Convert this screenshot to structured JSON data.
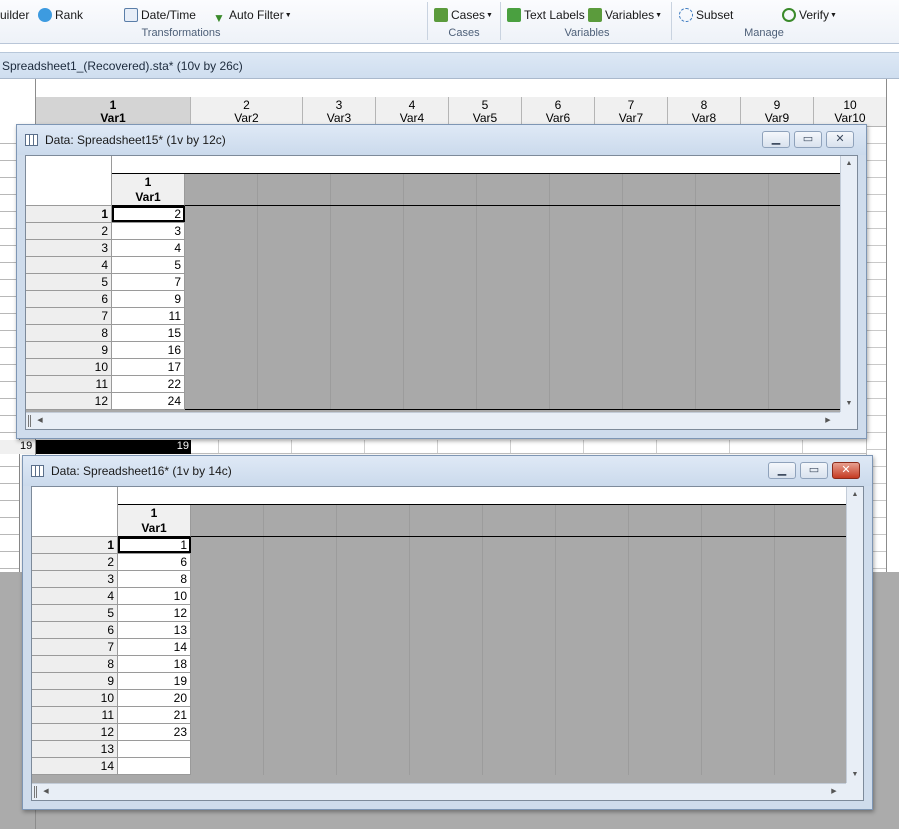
{
  "ribbon": {
    "items": [
      {
        "label": "uilder"
      },
      {
        "label": "Rank"
      },
      {
        "label": "Date/Time"
      },
      {
        "label": "Auto Filter"
      },
      {
        "label": "Cases"
      },
      {
        "label": "Text Labels"
      },
      {
        "label": "Variables"
      },
      {
        "label": "Subset"
      },
      {
        "label": "Verify"
      }
    ],
    "groups": [
      "Transformations",
      "Cases",
      "Variables",
      "Manage"
    ]
  },
  "background_sheet": {
    "title": "Spreadsheet1_(Recovered).sta* (10v by 26c)",
    "columns": [
      {
        "num": "1",
        "name": "Var1"
      },
      {
        "num": "2",
        "name": "Var2"
      },
      {
        "num": "3",
        "name": "Var3"
      },
      {
        "num": "4",
        "name": "Var4"
      },
      {
        "num": "5",
        "name": "Var5"
      },
      {
        "num": "6",
        "name": "Var6"
      },
      {
        "num": "7",
        "name": "Var7"
      },
      {
        "num": "8",
        "name": "Var8"
      },
      {
        "num": "9",
        "name": "Var9"
      },
      {
        "num": "10",
        "name": "Var10"
      }
    ],
    "visible_row": {
      "num": "19",
      "value": "19"
    }
  },
  "windows": [
    {
      "title": "Data: Spreadsheet15* (1v by 12c)",
      "col_num": "1",
      "col_name": "Var1",
      "rows": [
        {
          "n": "1",
          "v": "2"
        },
        {
          "n": "2",
          "v": "3"
        },
        {
          "n": "3",
          "v": "4"
        },
        {
          "n": "4",
          "v": "5"
        },
        {
          "n": "5",
          "v": "7"
        },
        {
          "n": "6",
          "v": "9"
        },
        {
          "n": "7",
          "v": "11"
        },
        {
          "n": "8",
          "v": "15"
        },
        {
          "n": "9",
          "v": "16"
        },
        {
          "n": "10",
          "v": "17"
        },
        {
          "n": "11",
          "v": "22"
        },
        {
          "n": "12",
          "v": "24"
        }
      ]
    },
    {
      "title": "Data: Spreadsheet16* (1v by 14c)",
      "col_num": "1",
      "col_name": "Var1",
      "rows": [
        {
          "n": "1",
          "v": "1"
        },
        {
          "n": "2",
          "v": "6"
        },
        {
          "n": "3",
          "v": "8"
        },
        {
          "n": "4",
          "v": "10"
        },
        {
          "n": "5",
          "v": "12"
        },
        {
          "n": "6",
          "v": "13"
        },
        {
          "n": "7",
          "v": "14"
        },
        {
          "n": "8",
          "v": "18"
        },
        {
          "n": "9",
          "v": "19"
        },
        {
          "n": "10",
          "v": "20"
        },
        {
          "n": "11",
          "v": "21"
        },
        {
          "n": "12",
          "v": "23"
        },
        {
          "n": "13",
          "v": ""
        },
        {
          "n": "14",
          "v": ""
        }
      ]
    }
  ],
  "colors": {
    "ribbon_group_label": "#4d5f78",
    "close_button": "#c53a22",
    "empty_area": "#ababab"
  }
}
